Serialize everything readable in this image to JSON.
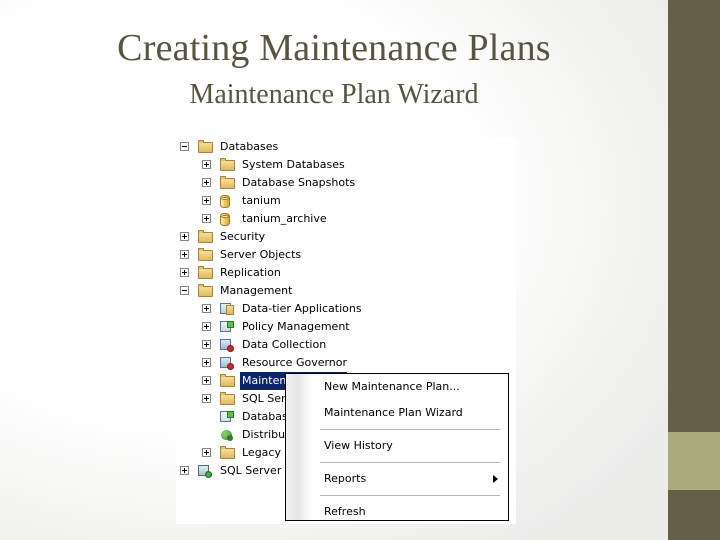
{
  "slide": {
    "title": "Creating Maintenance Plans",
    "subtitle": "Maintenance Plan Wizard",
    "title_color": "#595440",
    "accent_dark": "#655e48",
    "accent_light": "#a9aa7e"
  },
  "tree": {
    "items": [
      {
        "label": "Databases",
        "indent": 0,
        "expander": "minus",
        "icon": "folder-icon",
        "selected": false
      },
      {
        "label": "System Databases",
        "indent": 1,
        "expander": "plus",
        "icon": "folder-icon",
        "selected": false
      },
      {
        "label": "Database Snapshots",
        "indent": 1,
        "expander": "plus",
        "icon": "folder-icon",
        "selected": false
      },
      {
        "label": "tanium",
        "indent": 1,
        "expander": "plus",
        "icon": "database-icon",
        "selected": false
      },
      {
        "label": "tanium_archive",
        "indent": 1,
        "expander": "plus",
        "icon": "database-icon",
        "selected": false
      },
      {
        "label": "Security",
        "indent": 0,
        "expander": "plus",
        "icon": "folder-icon",
        "selected": false
      },
      {
        "label": "Server Objects",
        "indent": 0,
        "expander": "plus",
        "icon": "folder-icon",
        "selected": false
      },
      {
        "label": "Replication",
        "indent": 0,
        "expander": "plus",
        "icon": "folder-icon",
        "selected": false
      },
      {
        "label": "Management",
        "indent": 0,
        "expander": "minus",
        "icon": "folder-icon",
        "selected": false
      },
      {
        "label": "Data-tier Applications",
        "indent": 1,
        "expander": "plus",
        "icon": "data-tier-icon",
        "selected": false
      },
      {
        "label": "Policy Management",
        "indent": 1,
        "expander": "plus",
        "icon": "policy-icon",
        "selected": false
      },
      {
        "label": "Data Collection",
        "indent": 1,
        "expander": "plus",
        "icon": "data-collection-icon",
        "selected": false
      },
      {
        "label": "Resource Governor",
        "indent": 1,
        "expander": "plus",
        "icon": "resource-governor-icon",
        "selected": false
      },
      {
        "label": "Maintenance Plans",
        "indent": 1,
        "expander": "plus",
        "icon": "folder-icon",
        "selected": true
      },
      {
        "label": "SQL Server Logs",
        "indent": 1,
        "expander": "plus",
        "icon": "folder-icon",
        "selected": false
      },
      {
        "label": "Database Mail",
        "indent": 1,
        "expander": "none",
        "icon": "database-mail-icon",
        "selected": false
      },
      {
        "label": "Distributed Transaction Coordinator",
        "indent": 1,
        "expander": "none",
        "icon": "dtc-icon",
        "selected": false
      },
      {
        "label": "Legacy",
        "indent": 1,
        "expander": "plus",
        "icon": "folder-icon",
        "selected": false
      },
      {
        "label": "SQL Server Agent",
        "indent": 0,
        "expander": "plus",
        "icon": "sql-agent-icon",
        "selected": false
      }
    ]
  },
  "context_menu": {
    "items": [
      {
        "label": "New Maintenance Plan...",
        "submenu": false,
        "separator_after": false
      },
      {
        "label": "Maintenance Plan Wizard",
        "submenu": false,
        "separator_after": true
      },
      {
        "label": "View History",
        "submenu": false,
        "separator_after": true
      },
      {
        "label": "Reports",
        "submenu": true,
        "separator_after": true
      },
      {
        "label": "Refresh",
        "submenu": false,
        "separator_after": false
      }
    ]
  }
}
